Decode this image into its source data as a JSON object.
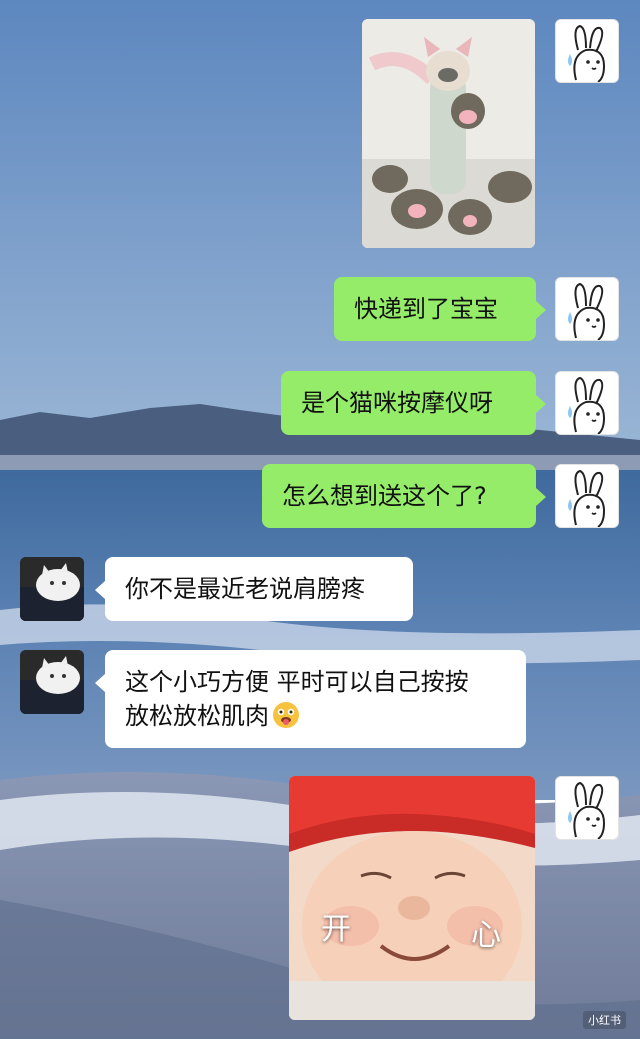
{
  "messages": {
    "m1_image": "cat-paw-massager-photo",
    "m2": "快递到了宝宝",
    "m3": "是个猫咪按摩仪呀",
    "m4": "怎么想到送这个了?",
    "m5": "你不是最近老说肩膀疼",
    "m6_line1": "这个小巧方便 平时可以自己按按",
    "m6_line2": "放松放松肌肉",
    "m7_sticker_left": "开",
    "m7_sticker_right": "心"
  },
  "watermark": "小红书",
  "colors": {
    "my_bubble": "#95ec69",
    "other_bubble": "#ffffff"
  },
  "icons": {
    "self_avatar": "bunny-sweat-avatar",
    "other_avatar": "white-cat-avatar"
  }
}
